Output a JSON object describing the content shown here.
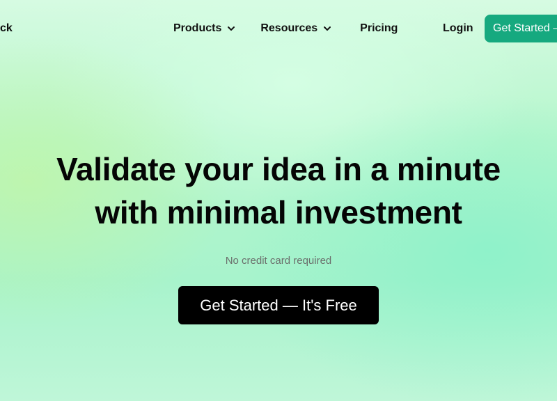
{
  "nav": {
    "brand_fragment": "ck",
    "items": [
      {
        "label": "Products",
        "icon": "chevron-down-icon"
      },
      {
        "label": "Resources",
        "icon": "chevron-down-icon"
      },
      {
        "label": "Pricing"
      }
    ],
    "login_label": "Login",
    "cta_label": "Get Started —"
  },
  "hero": {
    "title_line1": "Validate your idea in a minute",
    "title_line2": "with minimal investment",
    "subtext": "No credit card required",
    "cta_label": "Get Started — It's Free"
  },
  "colors": {
    "accent_green": "#16a97f",
    "primary_button": "#000000",
    "background_mint": "#b5f6cc"
  }
}
